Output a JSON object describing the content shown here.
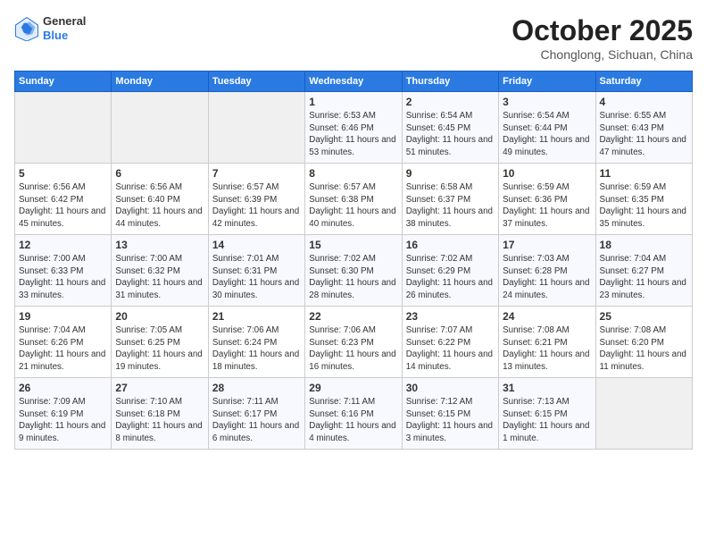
{
  "header": {
    "logo_line1": "General",
    "logo_line2": "Blue",
    "month": "October 2025",
    "location": "Chonglong, Sichuan, China"
  },
  "days_of_week": [
    "Sunday",
    "Monday",
    "Tuesday",
    "Wednesday",
    "Thursday",
    "Friday",
    "Saturday"
  ],
  "weeks": [
    [
      {
        "day": "",
        "empty": true
      },
      {
        "day": "",
        "empty": true
      },
      {
        "day": "",
        "empty": true
      },
      {
        "day": "1",
        "sunrise": "6:53 AM",
        "sunset": "6:46 PM",
        "daylight": "11 hours and 53 minutes."
      },
      {
        "day": "2",
        "sunrise": "6:54 AM",
        "sunset": "6:45 PM",
        "daylight": "11 hours and 51 minutes."
      },
      {
        "day": "3",
        "sunrise": "6:54 AM",
        "sunset": "6:44 PM",
        "daylight": "11 hours and 49 minutes."
      },
      {
        "day": "4",
        "sunrise": "6:55 AM",
        "sunset": "6:43 PM",
        "daylight": "11 hours and 47 minutes."
      }
    ],
    [
      {
        "day": "5",
        "sunrise": "6:56 AM",
        "sunset": "6:42 PM",
        "daylight": "11 hours and 45 minutes."
      },
      {
        "day": "6",
        "sunrise": "6:56 AM",
        "sunset": "6:40 PM",
        "daylight": "11 hours and 44 minutes."
      },
      {
        "day": "7",
        "sunrise": "6:57 AM",
        "sunset": "6:39 PM",
        "daylight": "11 hours and 42 minutes."
      },
      {
        "day": "8",
        "sunrise": "6:57 AM",
        "sunset": "6:38 PM",
        "daylight": "11 hours and 40 minutes."
      },
      {
        "day": "9",
        "sunrise": "6:58 AM",
        "sunset": "6:37 PM",
        "daylight": "11 hours and 38 minutes."
      },
      {
        "day": "10",
        "sunrise": "6:59 AM",
        "sunset": "6:36 PM",
        "daylight": "11 hours and 37 minutes."
      },
      {
        "day": "11",
        "sunrise": "6:59 AM",
        "sunset": "6:35 PM",
        "daylight": "11 hours and 35 minutes."
      }
    ],
    [
      {
        "day": "12",
        "sunrise": "7:00 AM",
        "sunset": "6:33 PM",
        "daylight": "11 hours and 33 minutes."
      },
      {
        "day": "13",
        "sunrise": "7:00 AM",
        "sunset": "6:32 PM",
        "daylight": "11 hours and 31 minutes."
      },
      {
        "day": "14",
        "sunrise": "7:01 AM",
        "sunset": "6:31 PM",
        "daylight": "11 hours and 30 minutes."
      },
      {
        "day": "15",
        "sunrise": "7:02 AM",
        "sunset": "6:30 PM",
        "daylight": "11 hours and 28 minutes."
      },
      {
        "day": "16",
        "sunrise": "7:02 AM",
        "sunset": "6:29 PM",
        "daylight": "11 hours and 26 minutes."
      },
      {
        "day": "17",
        "sunrise": "7:03 AM",
        "sunset": "6:28 PM",
        "daylight": "11 hours and 24 minutes."
      },
      {
        "day": "18",
        "sunrise": "7:04 AM",
        "sunset": "6:27 PM",
        "daylight": "11 hours and 23 minutes."
      }
    ],
    [
      {
        "day": "19",
        "sunrise": "7:04 AM",
        "sunset": "6:26 PM",
        "daylight": "11 hours and 21 minutes."
      },
      {
        "day": "20",
        "sunrise": "7:05 AM",
        "sunset": "6:25 PM",
        "daylight": "11 hours and 19 minutes."
      },
      {
        "day": "21",
        "sunrise": "7:06 AM",
        "sunset": "6:24 PM",
        "daylight": "11 hours and 18 minutes."
      },
      {
        "day": "22",
        "sunrise": "7:06 AM",
        "sunset": "6:23 PM",
        "daylight": "11 hours and 16 minutes."
      },
      {
        "day": "23",
        "sunrise": "7:07 AM",
        "sunset": "6:22 PM",
        "daylight": "11 hours and 14 minutes."
      },
      {
        "day": "24",
        "sunrise": "7:08 AM",
        "sunset": "6:21 PM",
        "daylight": "11 hours and 13 minutes."
      },
      {
        "day": "25",
        "sunrise": "7:08 AM",
        "sunset": "6:20 PM",
        "daylight": "11 hours and 11 minutes."
      }
    ],
    [
      {
        "day": "26",
        "sunrise": "7:09 AM",
        "sunset": "6:19 PM",
        "daylight": "11 hours and 9 minutes."
      },
      {
        "day": "27",
        "sunrise": "7:10 AM",
        "sunset": "6:18 PM",
        "daylight": "11 hours and 8 minutes."
      },
      {
        "day": "28",
        "sunrise": "7:11 AM",
        "sunset": "6:17 PM",
        "daylight": "11 hours and 6 minutes."
      },
      {
        "day": "29",
        "sunrise": "7:11 AM",
        "sunset": "6:16 PM",
        "daylight": "11 hours and 4 minutes."
      },
      {
        "day": "30",
        "sunrise": "7:12 AM",
        "sunset": "6:15 PM",
        "daylight": "11 hours and 3 minutes."
      },
      {
        "day": "31",
        "sunrise": "7:13 AM",
        "sunset": "6:15 PM",
        "daylight": "11 hours and 1 minute."
      },
      {
        "day": "",
        "empty": true
      }
    ]
  ]
}
